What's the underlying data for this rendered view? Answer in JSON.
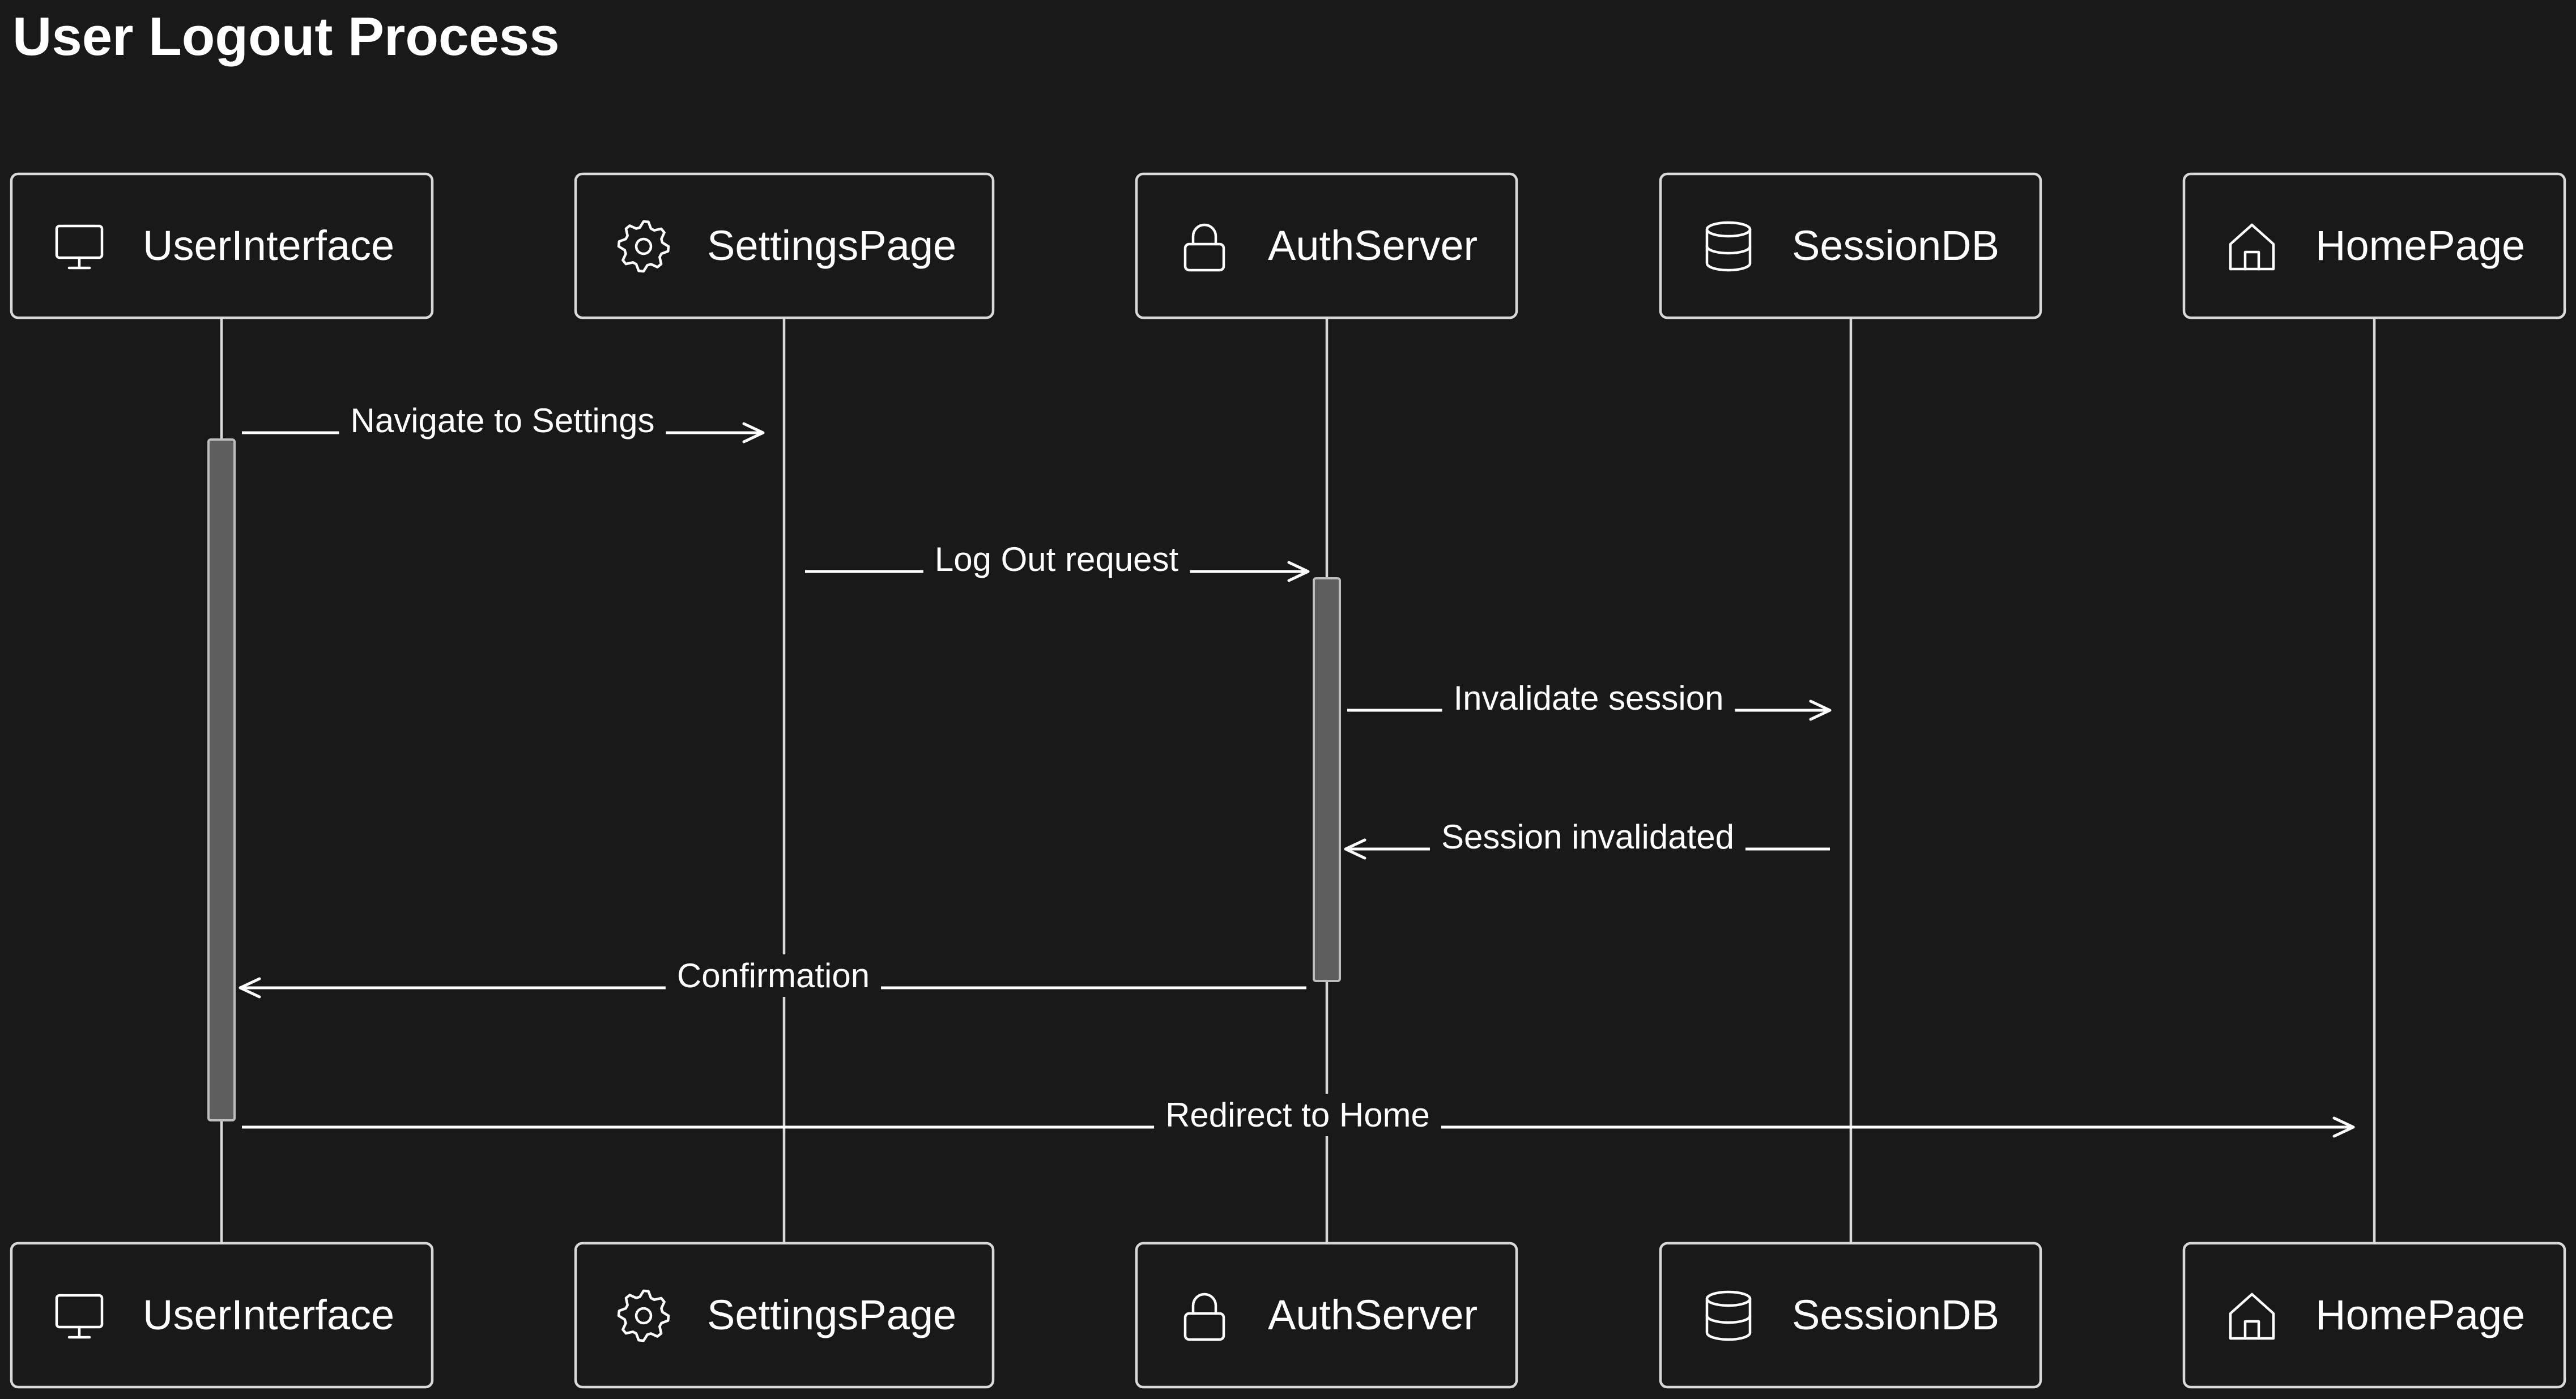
{
  "title": "User Logout Process",
  "participants": [
    {
      "id": "ui",
      "label": "UserInterface",
      "icon": "monitor-icon"
    },
    {
      "id": "settings",
      "label": "SettingsPage",
      "icon": "gear-icon"
    },
    {
      "id": "auth",
      "label": "AuthServer",
      "icon": "lock-icon"
    },
    {
      "id": "db",
      "label": "SessionDB",
      "icon": "database-icon"
    },
    {
      "id": "home",
      "label": "HomePage",
      "icon": "home-icon"
    }
  ],
  "messages": [
    {
      "from": "ui",
      "to": "settings",
      "label": "Navigate to Settings"
    },
    {
      "from": "settings",
      "to": "auth",
      "label": "Log Out request"
    },
    {
      "from": "auth",
      "to": "db",
      "label": "Invalidate session"
    },
    {
      "from": "db",
      "to": "auth",
      "label": "Session invalidated"
    },
    {
      "from": "auth",
      "to": "ui",
      "label": "Confirmation"
    },
    {
      "from": "ui",
      "to": "home",
      "label": "Redirect to Home"
    }
  ],
  "activations": [
    {
      "participant": "ui",
      "from_message": 0,
      "to_message": 5
    },
    {
      "participant": "auth",
      "from_message": 1,
      "to_message": 4
    }
  ]
}
